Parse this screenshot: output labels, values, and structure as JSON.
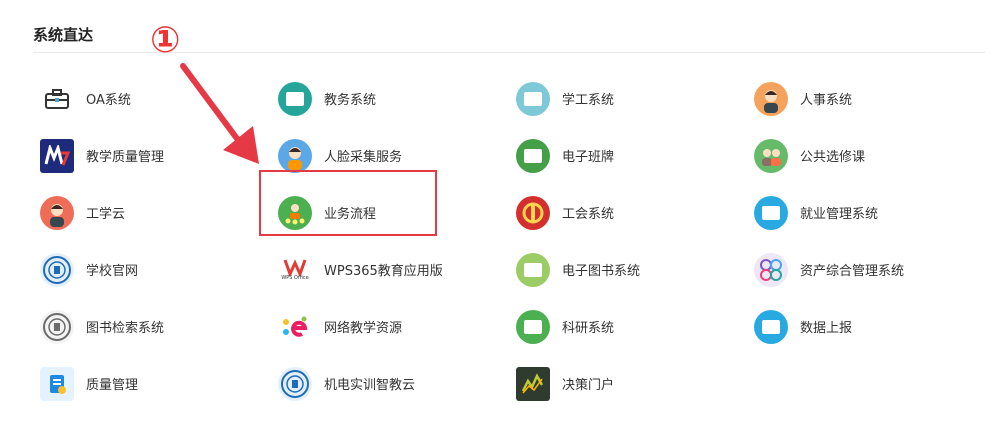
{
  "section": {
    "title": "系统直达"
  },
  "annotation": {
    "number": "①"
  },
  "tiles": [
    {
      "label": "OA系统",
      "icon": "briefcase-icon",
      "color": "#ffffff",
      "fg": "#3a3a3a"
    },
    {
      "label": "教务系统",
      "icon": "academic-icon",
      "color": "#26a69a",
      "fg": "#ffffff"
    },
    {
      "label": "学工系统",
      "icon": "document-icon",
      "color": "#7ec9d8",
      "fg": "#ffffff"
    },
    {
      "label": "人事系统",
      "icon": "personnel-icon",
      "color": "#f5a25d",
      "fg": "#ffffff"
    },
    {
      "label": "教学质量管理",
      "icon": "my-logo-icon",
      "color": "#1e2a7b",
      "fg": "#e53935"
    },
    {
      "label": "人脸采集服务",
      "icon": "face-icon",
      "color": "#5aa9e6",
      "fg": "#ffffff"
    },
    {
      "label": "电子班牌",
      "icon": "board-icon",
      "color": "#43a047",
      "fg": "#ffffff"
    },
    {
      "label": "公共选修课",
      "icon": "group-icon",
      "color": "#66bb6a",
      "fg": "#ffffff"
    },
    {
      "label": "工学云",
      "icon": "worker-icon",
      "color": "#ef6c57",
      "fg": "#ffffff"
    },
    {
      "label": "业务流程",
      "icon": "workflow-icon",
      "color": "#4caf50",
      "fg": "#ffffff"
    },
    {
      "label": "工会系统",
      "icon": "union-emblem-icon",
      "color": "#d32f2f",
      "fg": "#ffd54f"
    },
    {
      "label": "就业管理系统",
      "icon": "chart-board-icon",
      "color": "#29a9e1",
      "fg": "#ffffff"
    },
    {
      "label": "学校官网",
      "icon": "school-seal-icon",
      "color": "#e3f0fb",
      "fg": "#1e6bb8"
    },
    {
      "label": "WPS365教育应用版",
      "icon": "wps-icon",
      "color": "#ffffff",
      "fg": "#e53935"
    },
    {
      "label": "电子图书系统",
      "icon": "ebook-icon",
      "color": "#9ccc65",
      "fg": "#ffffff"
    },
    {
      "label": "资产综合管理系统",
      "icon": "asset-icon",
      "color": "#ede7f6",
      "fg": "#7e57c2"
    },
    {
      "label": "图书检索系统",
      "icon": "library-seal-icon",
      "color": "#f3f3f3",
      "fg": "#6b6b6b"
    },
    {
      "label": "网络教学资源",
      "icon": "colorful-e-icon",
      "color": "#ffffff",
      "fg": "#e91e63"
    },
    {
      "label": "科研系统",
      "icon": "research-icon",
      "color": "#4caf50",
      "fg": "#ffffff"
    },
    {
      "label": "数据上报",
      "icon": "data-report-icon",
      "color": "#29a9e1",
      "fg": "#ffffff"
    },
    {
      "label": "质量管理",
      "icon": "quality-icon",
      "color": "#e3f2fd",
      "fg": "#1e88e5"
    },
    {
      "label": "机电实训智教云",
      "icon": "school-seal-icon",
      "color": "#e3f0fb",
      "fg": "#1e6bb8"
    },
    {
      "label": "决策门户",
      "icon": "decision-chart-icon",
      "color": "#2e3b2e",
      "fg": "#c0ca33"
    }
  ],
  "wps_small_text": "WPS Office"
}
